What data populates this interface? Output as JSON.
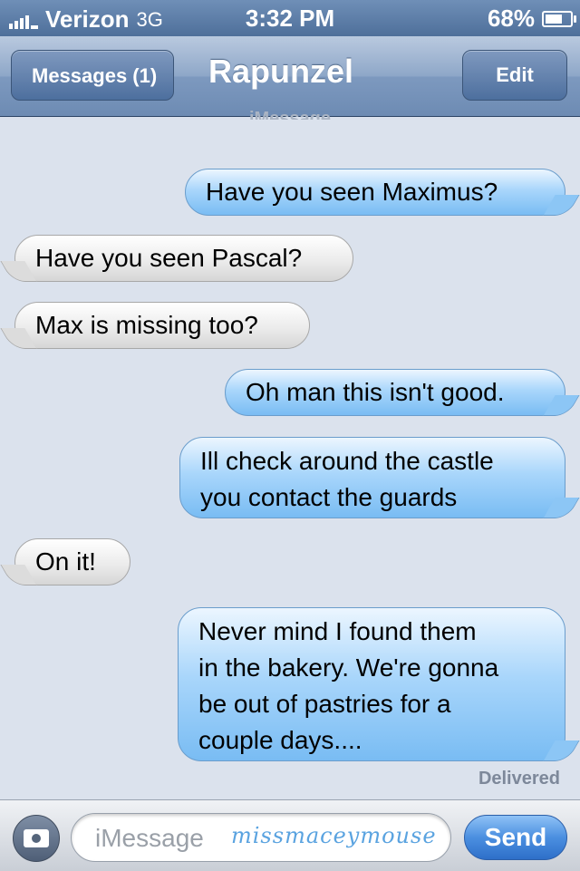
{
  "status_bar": {
    "carrier": "Verizon",
    "network": "3G",
    "time": "3:32 PM",
    "battery": "68%",
    "battery_level": 0.68
  },
  "nav": {
    "back_label": "Messages (1)",
    "title": "Rapunzel",
    "edit_label": "Edit"
  },
  "thread": {
    "service_label": "iMessage",
    "messages": [
      {
        "direction": "out",
        "text": "Have you seen Maximus?"
      },
      {
        "direction": "in",
        "text": "Have you seen Pascal?"
      },
      {
        "direction": "in",
        "text": "Max is missing too?"
      },
      {
        "direction": "out",
        "text": "Oh man this isn't good."
      },
      {
        "direction": "out",
        "text": "Ill check around the castle\nyou contact the guards"
      },
      {
        "direction": "in",
        "text": "On it!"
      },
      {
        "direction": "out",
        "text": "Never mind I found them\nin the bakery. We're gonna\nbe out of pastries for a\ncouple days...."
      }
    ],
    "delivered_label": "Delivered"
  },
  "input_bar": {
    "placeholder": "iMessage",
    "watermark": "missmaceymouse",
    "send_label": "Send",
    "camera_icon": "camera-icon"
  },
  "colors": {
    "outgoing_bubble": "#8cc6f5",
    "incoming_bubble": "#e6e6e6",
    "nav_bar": "#7d99bf",
    "send_button": "#4b8fe0"
  }
}
